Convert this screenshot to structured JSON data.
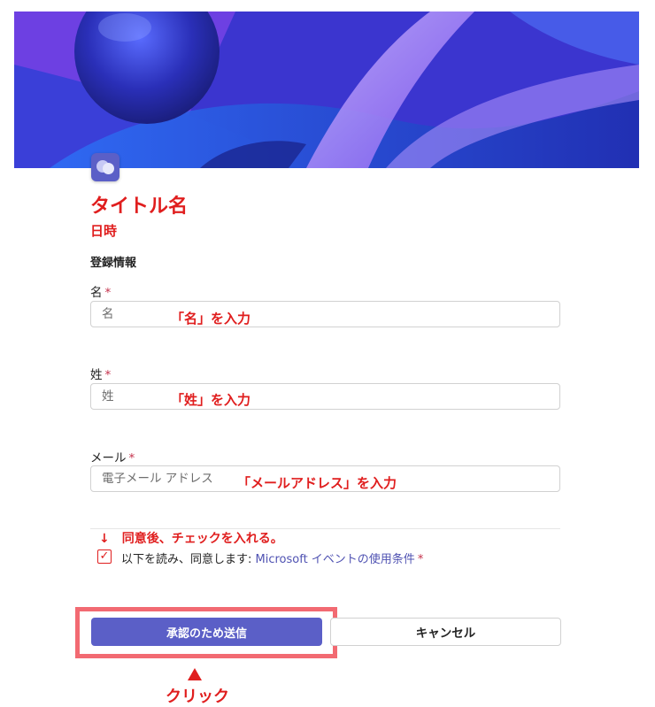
{
  "form": {
    "title": "タイトル名",
    "datetime": "日時",
    "section_title": "登録情報",
    "required_mark": "*",
    "fields": [
      {
        "label": "名",
        "placeholder": "名",
        "annotation": "「名」を入力"
      },
      {
        "label": "姓",
        "placeholder": "姓",
        "annotation": "「姓」を入力"
      },
      {
        "label": "メール",
        "placeholder": "電子メール アドレス",
        "annotation": "「メールアドレス」を入力"
      }
    ],
    "consent": {
      "annotation": "↓　同意後、チェックを入れる。",
      "checkmark": "✓",
      "text": "以下を読み、同意します: ",
      "link": "Microsoft イベントの使用条件"
    },
    "buttons": {
      "submit": "承認のため送信",
      "cancel": "キャンセル"
    },
    "click_annotation": "クリック"
  },
  "colors": {
    "accent": "#5b5fc7",
    "annotation_red": "#e01e1e",
    "highlight_border": "#f26a72",
    "required": "#c4314b",
    "banner_base": "#3a3fd8"
  },
  "icons": {
    "logo": "teams-chat-logo-icon",
    "arrow": "red-up-arrow-icon"
  }
}
